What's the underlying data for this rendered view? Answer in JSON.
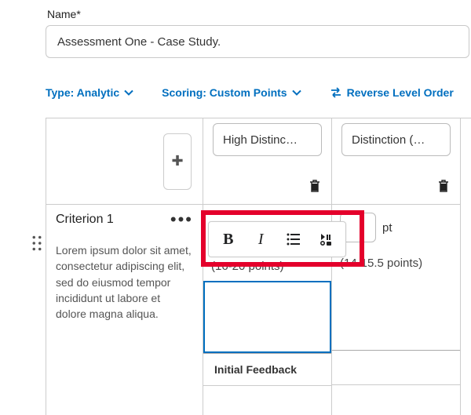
{
  "name": {
    "label": "Name*",
    "value": "Assessment One - Case Study."
  },
  "controls": {
    "type_label": "Type: Analytic",
    "scoring_label": "Scoring: Custom Points",
    "reverse_label": "Reverse Level Order"
  },
  "levels": [
    {
      "name": "High Distinc…",
      "points_visible": "",
      "range": "(16-20 points)"
    },
    {
      "name": "Distinction (…",
      "points_visible": "",
      "range": "(14-15.5 points)"
    }
  ],
  "criterion": {
    "name": "Criterion 1",
    "description": "Lorem ipsum dolor sit amet, consectetur adipiscing elit, sed do eiusmod tempor incididunt ut labore et dolore magna aliqua."
  },
  "pt_label": "pt",
  "initial_feedback_label": "Initial Feedback",
  "toolbar": {
    "bold": "B",
    "italic": "I"
  }
}
